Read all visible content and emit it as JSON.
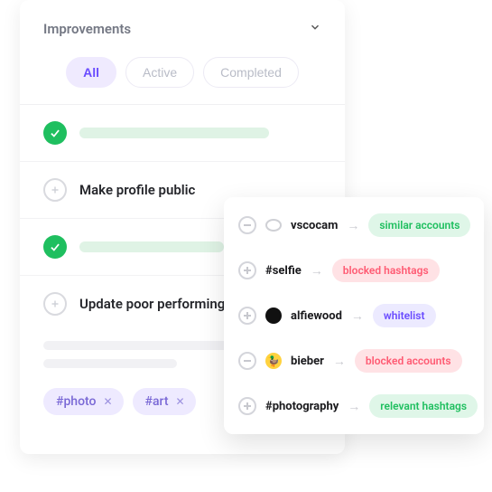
{
  "panel": {
    "title": "Improvements",
    "tabs": {
      "all": "All",
      "active": "Active",
      "completed": "Completed"
    },
    "rows": {
      "r1_text": "Make profile public",
      "r3_text": "Update poor performing targ"
    },
    "chips": {
      "c0": "#photo",
      "c1": "#art"
    }
  },
  "suggestions": {
    "s0": {
      "label": "vscocam",
      "pill": "similar accounts"
    },
    "s1": {
      "label": "#selfie",
      "pill": "blocked hashtags"
    },
    "s2": {
      "label": "alfiewood",
      "pill": "whitelist"
    },
    "s3": {
      "label": "bieber",
      "pill": "blocked accounts"
    },
    "s4": {
      "label": "#photography",
      "pill": "relevant hashtags"
    }
  }
}
